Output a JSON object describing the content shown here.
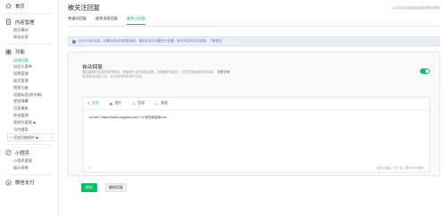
{
  "sidebar": {
    "home": {
      "label": "首页",
      "icon": "home-icon"
    },
    "content_mgmt": {
      "label": "内容管理",
      "icon": "document-icon",
      "items": [
        "图文素材",
        "原创文章"
      ]
    },
    "features": {
      "label": "功能",
      "icon": "grid-icon",
      "items": [
        "自动回复",
        "自定义菜单",
        "投票管理",
        "留言管理",
        "赞赏功能",
        "话题标签(原专辑)",
        "视频弹幕",
        "页面模板",
        "原创管理",
        "视频号管理",
        "号内搜索"
      ],
      "active_index": 0,
      "badge_index": 9
    },
    "add_plugin_label": "添加功能插件",
    "mini_program": {
      "label": "小程序",
      "icon": "mini-program-icon",
      "items": [
        "小程序管理",
        "展示场景"
      ]
    },
    "wechat_pay": {
      "label": "微信支付",
      "icon": "pay-icon"
    }
  },
  "main": {
    "title": "被关注回复",
    "tip": "公众平台自动回复功能处理相关规则",
    "tabs": [
      "关键词回复",
      "收到消息回复",
      "被关注回复"
    ],
    "active_tab": 2,
    "notice": "自2023年6月起，如需启用自动回复规则，请前往相关设置进行配置，相关内容请点击查看。了解更多",
    "panel": {
      "title": "自动回复",
      "description": "通过编辑内容或关键词规则，快速进行自动回复设置。如具备开发能力，可更灵活地使用该功能。",
      "description_link": "查看详情",
      "description_line2": "关闭自动回复之后，将立即对所有用户生效。",
      "toggle_on": true
    },
    "editor": {
      "tabs": [
        {
          "label": "文字",
          "icon": "text-icon"
        },
        {
          "label": "图片",
          "icon": "image-icon"
        },
        {
          "label": "音频",
          "icon": "audio-icon"
        },
        {
          "label": "视频",
          "icon": "video-icon"
        }
      ],
      "active_tab": 0,
      "content": "<a href=\"https://www.xmyzstw.com/\">小说在线阅读</a>",
      "counter": "还可以输入 537 字，按下Enter换行"
    },
    "buttons": {
      "save": "保存",
      "delete": "删除回复"
    }
  },
  "colors": {
    "accent": "#07c160",
    "notice_bg": "#e9eef8",
    "badge": "#e24a4a"
  }
}
